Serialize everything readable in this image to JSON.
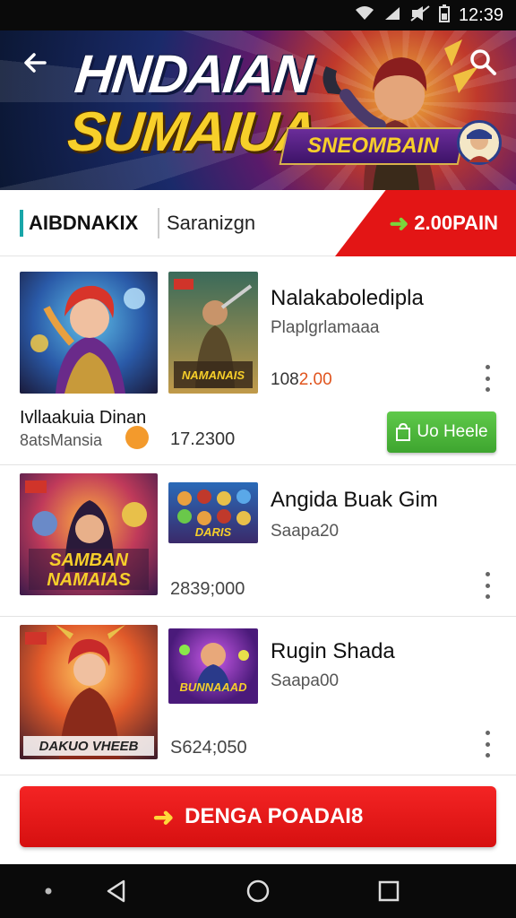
{
  "status_bar": {
    "time": "12:39"
  },
  "header": {
    "title_line1": "HNDAIAN",
    "title_line2": "SUMAIUA",
    "badge_text": "SNEOMBAIN"
  },
  "tabs": {
    "tab1_label": "AIBDNAKIX",
    "tab2_label": "Saranizgn",
    "price_label": "2.00PAIN"
  },
  "items": [
    {
      "title": "Nalakaboledipla",
      "subtitle": "Plaplgrlamaaa",
      "price": "108",
      "price_highlight": "2.00",
      "caption": "Ivllaakuia Dinan",
      "caption_sub": "8atsMansia",
      "figure": "17.2300",
      "button_label": "Uo Heele",
      "thumb_label": "NAMANAIS"
    },
    {
      "title": "Angida Buak Gim",
      "subtitle": "Saapa20",
      "figure": "2839;000",
      "thumb_big_label": "SAMBAN NAMAIAS",
      "thumb_small_label": "DARIS"
    },
    {
      "title": "Rugin Shada",
      "subtitle": "Saapa00",
      "figure": "S624;050",
      "thumb_big_label": "DAKUO VHEEB",
      "thumb_small_label": "BUNNAAAD"
    }
  ],
  "cta": {
    "label": "DENGA POADAI8"
  },
  "colors": {
    "accent_red": "#e31515",
    "accent_green": "#4cb83a",
    "accent_teal": "#18a6a8",
    "title_yellow": "#f7cf2a"
  }
}
